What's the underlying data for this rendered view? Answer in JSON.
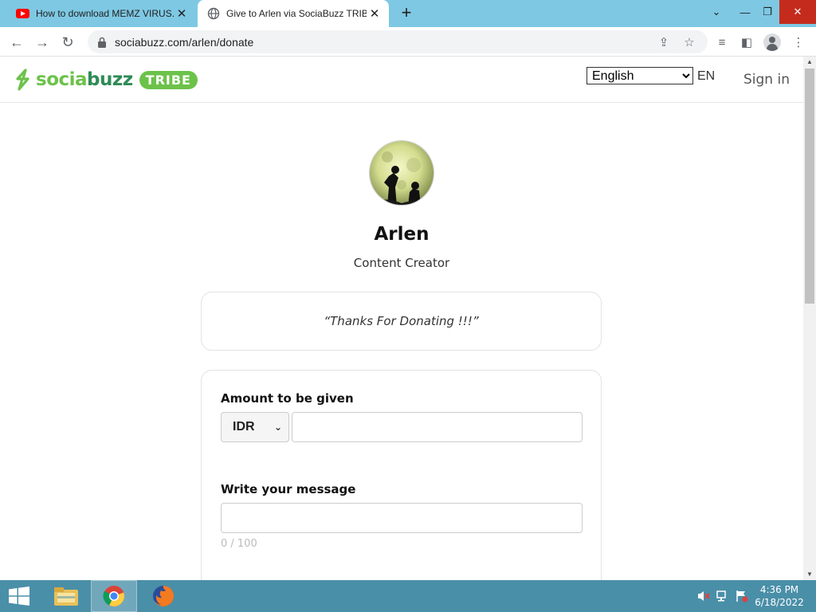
{
  "browser": {
    "tabs": [
      {
        "title": "How to download MEMZ VIRUS.",
        "icon": "youtube-icon",
        "active": false
      },
      {
        "title": "Give to Arlen via SociaBuzz TRIBE",
        "icon": "globe-icon",
        "active": true
      }
    ],
    "url": "sociabuzz.com/arlen/donate"
  },
  "header": {
    "logo_text_1": "socia",
    "logo_text_2": "buzz",
    "logo_badge": "TRIBE",
    "language_selected": "English",
    "language_code": "EN",
    "sign_in": "Sign in"
  },
  "profile": {
    "name": "Arlen",
    "role": "Content Creator"
  },
  "quote": {
    "text": "“Thanks For Donating !!!”"
  },
  "form": {
    "amount_label": "Amount to be given",
    "currency": "IDR",
    "amount_value": "",
    "message_label": "Write your message",
    "message_value": "",
    "char_count": "0 / 100"
  },
  "taskbar": {
    "time": "4:36 PM",
    "date": "6/18/2022"
  },
  "colors": {
    "brand_green": "#6cc24a",
    "tabstrip": "#7ec8e3",
    "taskbar": "#4a8fa8",
    "close_red": "#c42b1c"
  }
}
